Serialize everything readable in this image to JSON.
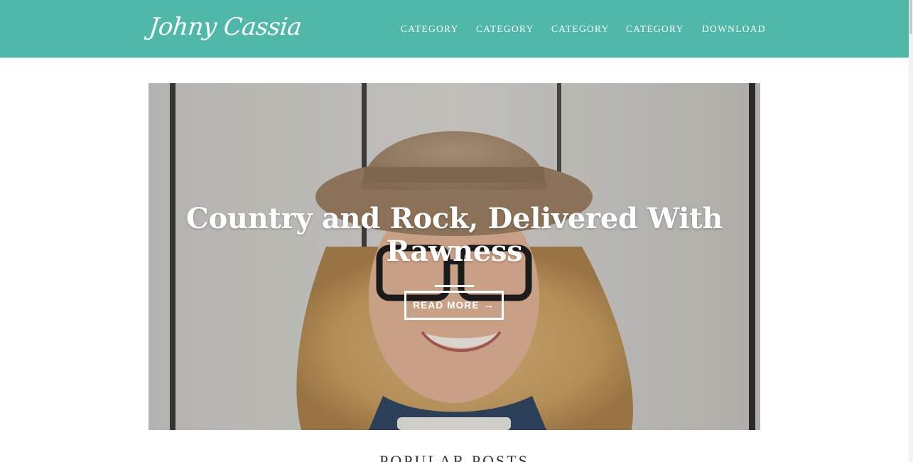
{
  "header": {
    "logo": "Johny Cassia",
    "nav": [
      "CATEGORY",
      "CATEGORY",
      "CATEGORY",
      "CATEGORY",
      "DOWNLOAD"
    ]
  },
  "hero": {
    "title_line1": "Country and Rock, Delivered With",
    "title_line2": "Rawness",
    "button_label": "READ MORE",
    "button_icon": "arrow-right-icon"
  },
  "section": {
    "popular_heading": "POPULAR POSTS"
  },
  "colors": {
    "header_bg": "#4fb8a8",
    "text_light": "#ffffff"
  }
}
